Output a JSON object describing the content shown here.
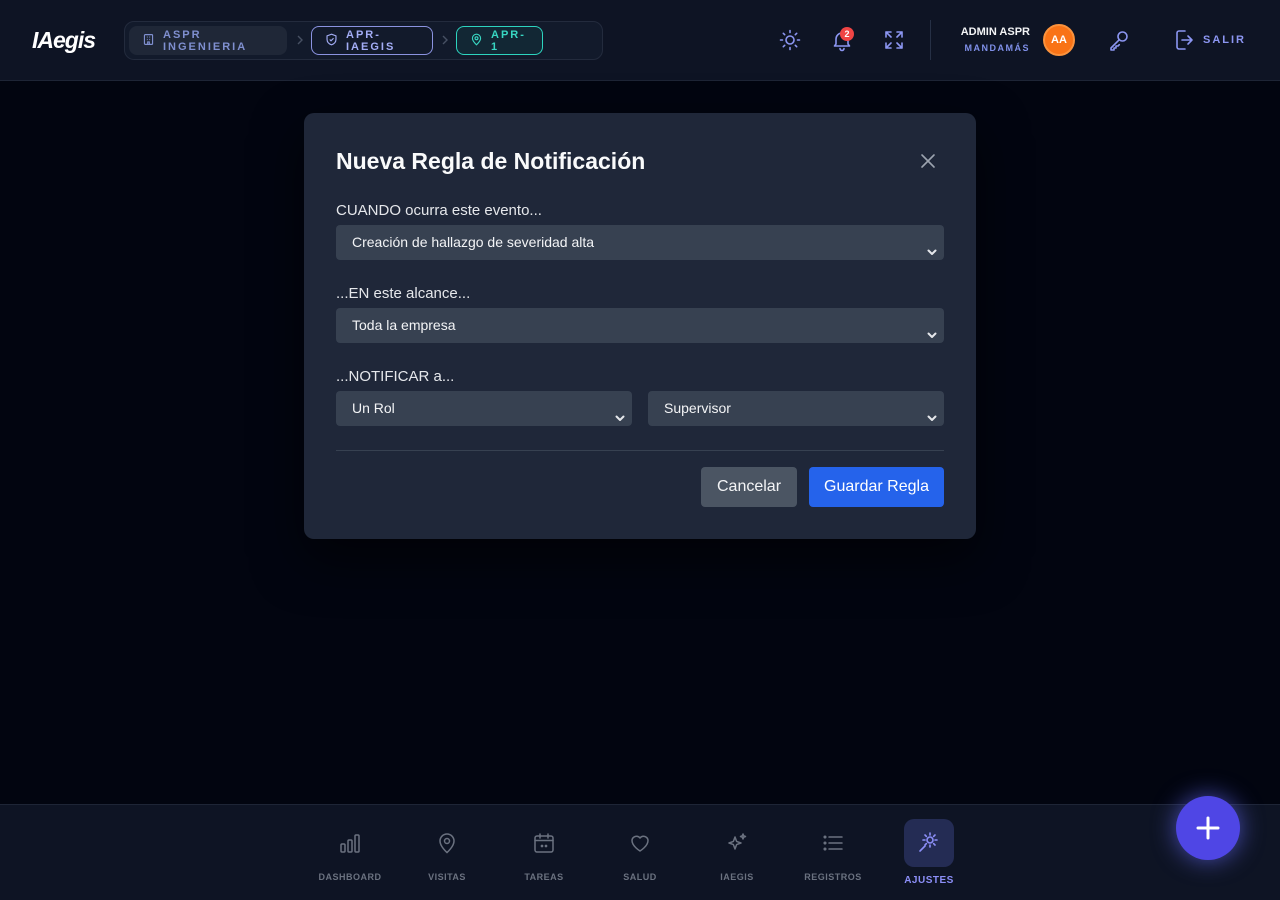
{
  "header": {
    "logo": "IAegis",
    "breadcrumb": [
      {
        "label": "ASPR INGENIERIA",
        "icon": "building-icon"
      },
      {
        "label": "APR-IAEGIS",
        "icon": "shield-icon"
      },
      {
        "label": "APR-1",
        "icon": "map-pin-icon"
      }
    ],
    "notifications_count": "2",
    "user": {
      "name": "ADMIN ASPR",
      "role": "MANDAMÁS",
      "initials": "AA"
    },
    "logout_label": "SALIR"
  },
  "modal": {
    "title": "Nueva Regla de Notificación",
    "event_label": "CUANDO ocurra este evento...",
    "event_value": "Creación de hallazgo de severidad alta",
    "scope_label": "...EN este alcance...",
    "scope_value": "Toda la empresa",
    "notify_label": "...NOTIFICAR a...",
    "notify_type_value": "Un Rol",
    "notify_target_value": "Supervisor",
    "cancel_label": "Cancelar",
    "save_label": "Guardar Regla"
  },
  "bottom_nav": [
    {
      "label": "DASHBOARD",
      "icon": "bar-chart-icon",
      "active": false
    },
    {
      "label": "VISITAS",
      "icon": "map-pin-icon",
      "active": false
    },
    {
      "label": "TAREAS",
      "icon": "calendar-icon",
      "active": false
    },
    {
      "label": "SALUD",
      "icon": "heart-icon",
      "active": false
    },
    {
      "label": "IAEGIS",
      "icon": "sparkles-icon",
      "active": false
    },
    {
      "label": "REGISTROS",
      "icon": "list-icon",
      "active": false
    },
    {
      "label": "AJUSTES",
      "icon": "settings-icon",
      "active": true
    }
  ],
  "colors": {
    "accent": "#4f46e5",
    "primary_button": "#2563eb",
    "avatar": "#f97316",
    "badge": "#ef4444",
    "site_crumb": "#2dd4bf"
  }
}
